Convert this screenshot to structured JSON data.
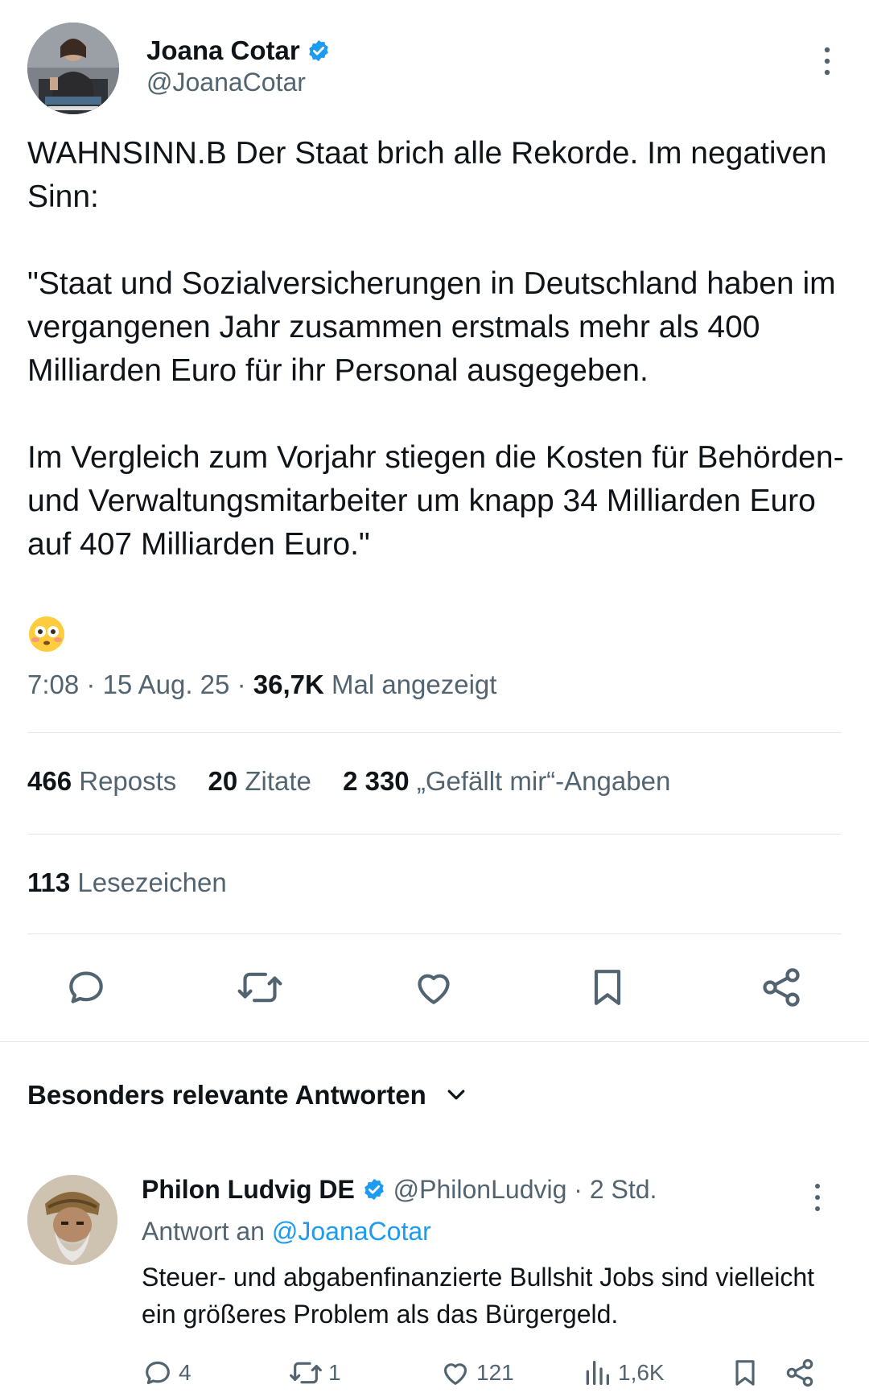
{
  "author": {
    "name": "Joana Cotar",
    "handle": "@JoanaCotar",
    "verified_color": "#1d9bf0"
  },
  "tweet": {
    "text": "WAHNSINN.B Der Staat brich alle Rekorde. Im negativen  Sinn:\n\n\"Staat und Sozialversicherungen in Deutschland haben im vergangenen Jahr zusammen erstmals mehr als 400 Milliarden Euro für ihr Personal ausgegeben.\n\nIm Vergleich zum Vorjahr stiegen die Kosten für Behörden- und Verwaltungsmitarbeiter um knapp 34 Milliarden Euro auf 407 Milliarden Euro.\"",
    "emoji": "flushed-face",
    "time": "7:08",
    "separator": "·",
    "date": "15 Aug. 25",
    "views_count": "36,7K",
    "views_label": "Mal angezeigt"
  },
  "stats": {
    "reposts_count": "466",
    "reposts_label": "Reposts",
    "quotes_count": "20",
    "quotes_label": "Zitate",
    "likes_count": "2 330",
    "likes_label": "„Gefällt mir“-Angaben",
    "bookmarks_count": "113",
    "bookmarks_label": "Lesezeichen"
  },
  "actions": [
    "reply-icon",
    "repost-icon",
    "like-icon",
    "bookmark-icon",
    "share-icon"
  ],
  "replies_section": {
    "sort_label": "Besonders relevante Antworten"
  },
  "reply": {
    "name": "Philon Ludvig DE",
    "handle": "@PhilonLudvig",
    "time": "2 Std.",
    "reply_to_label": "Antwort an",
    "reply_to_handle": "@JoanaCotar",
    "text": "Steuer- und abgabenfinanzierte Bullshit Jobs sind vielleicht ein größeres Problem als das Bürgergeld.",
    "reply_count": "4",
    "repost_count": "1",
    "like_count": "121",
    "view_count": "1,6K"
  },
  "colors": {
    "accent": "#1d9bf0",
    "text_primary": "#0f1419",
    "text_secondary": "#536471",
    "divider": "#e1e6ea"
  }
}
